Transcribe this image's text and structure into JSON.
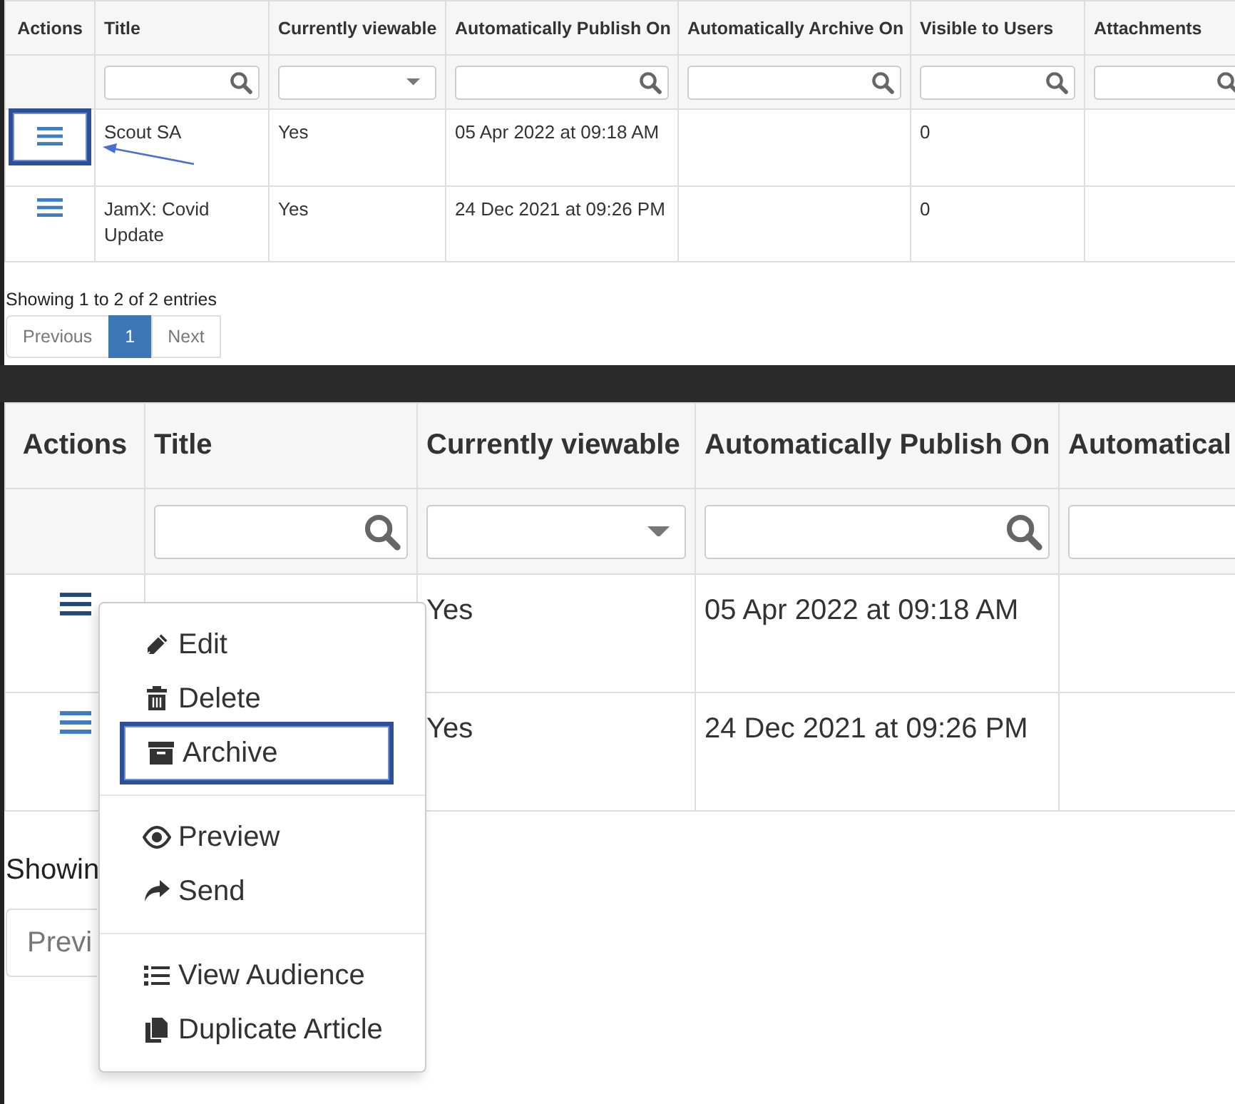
{
  "top_panel": {
    "actions_column": "Actions",
    "columns": [
      "Title",
      "Currently viewable",
      "Automatically Publish On",
      "Automatically Archive On",
      "Visible to Users",
      "Attachments"
    ],
    "filters": [
      {
        "kind": "search"
      },
      {
        "kind": "select"
      },
      {
        "kind": "search"
      },
      {
        "kind": "search"
      },
      {
        "kind": "search"
      },
      {
        "kind": "search"
      }
    ],
    "rows": [
      {
        "highlighted": true,
        "menu_open": false,
        "cells": [
          "Scout SA",
          "Yes",
          "05 Apr 2022 at 09:18 AM",
          null,
          "0",
          null
        ]
      },
      {
        "highlighted": false,
        "menu_open": false,
        "cells": [
          "JamX: Covid Update",
          "Yes",
          "24 Dec 2021 at 09:26 PM",
          null,
          "0",
          null
        ]
      }
    ],
    "info": "Showing 1 to 2 of 2 entries",
    "pagination": [
      {
        "label": "Previous",
        "selected": false
      },
      {
        "label": "1",
        "selected": true
      },
      {
        "label": "Next",
        "selected": false
      }
    ]
  },
  "bottom_panel": {
    "actions_column": "Actions",
    "columns": [
      "Title",
      "Currently viewable",
      "Automatically Publish On",
      "Automatical"
    ],
    "filters": [
      {
        "kind": "search"
      },
      {
        "kind": "select"
      },
      {
        "kind": "search"
      },
      {
        "kind": "text"
      }
    ],
    "rows": [
      {
        "highlighted": false,
        "menu_open": true,
        "cells": [
          null,
          "Yes",
          "05 Apr 2022 at 09:18 AM",
          null
        ]
      },
      {
        "highlighted": false,
        "menu_open": false,
        "cells": [
          null,
          "Yes",
          "24 Dec 2021 at 09:26 PM",
          null
        ]
      }
    ],
    "info": "Showin",
    "pagination": [
      {
        "label": "Previ",
        "selected": false
      }
    ],
    "menu": [
      [
        {
          "kind": "edit",
          "label": "Edit",
          "highlighted": false
        },
        {
          "kind": "delete",
          "label": "Delete",
          "highlighted": false
        },
        {
          "kind": "archive",
          "label": "Archive",
          "highlighted": true
        }
      ],
      [
        {
          "kind": "preview",
          "label": "Preview",
          "highlighted": false
        },
        {
          "kind": "send",
          "label": "Send",
          "highlighted": false
        }
      ],
      [
        {
          "kind": "audience",
          "label": "View Audience",
          "highlighted": false
        },
        {
          "kind": "duplicate",
          "label": "Duplicate Article",
          "highlighted": false
        }
      ]
    ]
  }
}
